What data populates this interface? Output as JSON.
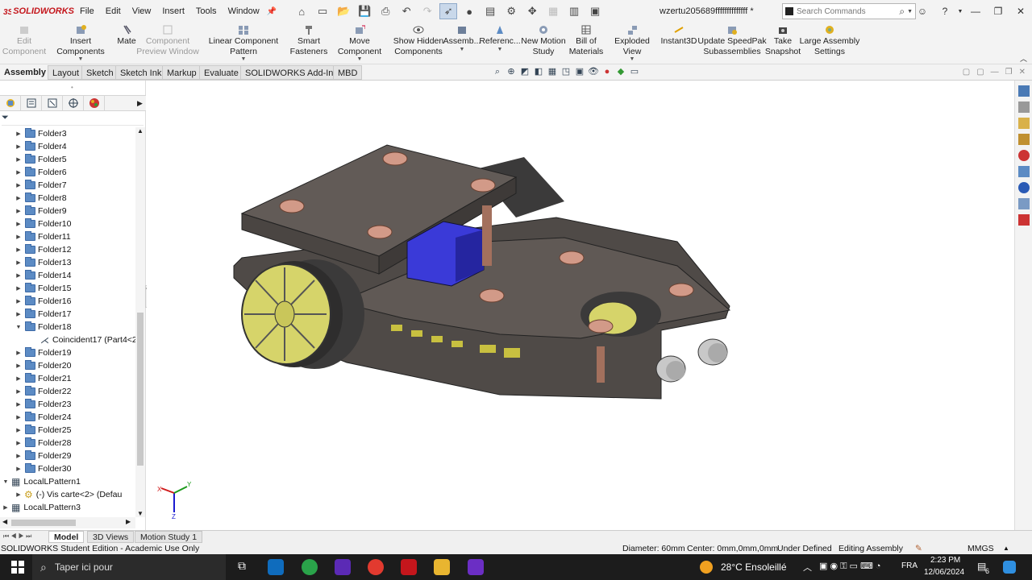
{
  "app": {
    "name": "SOLIDWORKS",
    "doc_title": "wzertu205689ffffffffffffff *"
  },
  "menu": [
    "File",
    "Edit",
    "View",
    "Insert",
    "Tools",
    "Window"
  ],
  "search": {
    "placeholder": "Search Commands"
  },
  "ribbon": [
    {
      "label": "Edit\nComponent"
    },
    {
      "label": "Insert Components"
    },
    {
      "label": "Mate"
    },
    {
      "label": "Component\nPreview Window"
    },
    {
      "label": "Linear Component Pattern"
    },
    {
      "label": "Smart\nFasteners"
    },
    {
      "label": "Move Component"
    },
    {
      "label": "Show Hidden\nComponents"
    },
    {
      "label": "Assemb..."
    },
    {
      "label": "Referenc..."
    },
    {
      "label": "New Motion\nStudy"
    },
    {
      "label": "Bill of\nMaterials"
    },
    {
      "label": "Exploded View"
    },
    {
      "label": "Instant3D"
    },
    {
      "label": "Update SpeedPak\nSubassemblies"
    },
    {
      "label": "Take\nSnapshot"
    },
    {
      "label": "Large Assembly\nSettings"
    }
  ],
  "tabs": [
    "Assembly",
    "Layout",
    "Sketch",
    "Sketch Ink",
    "Markup",
    "Evaluate",
    "SOLIDWORKS Add-Ins",
    "MBD"
  ],
  "tree": [
    "Folder3",
    "Folder4",
    "Folder5",
    "Folder6",
    "Folder7",
    "Folder8",
    "Folder9",
    "Folder10",
    "Folder11",
    "Folder12",
    "Folder13",
    "Folder14",
    "Folder15",
    "Folder16",
    "Folder17",
    "Folder18",
    "Coincident17 (Part4<2>",
    "Folder19",
    "Folder20",
    "Folder21",
    "Folder22",
    "Folder23",
    "Folder24",
    "Folder25",
    "Folder28",
    "Folder29",
    "Folder30",
    "LocalLPattern1",
    "(-) Vis carte<2> (Defau",
    "LocalLPattern3"
  ],
  "bottom_tabs": [
    "Model",
    "3D Views",
    "Motion Study 1"
  ],
  "status": {
    "left": "SOLIDWORKS Student Edition - Academic Use Only",
    "diameter": "Diameter: 60mm",
    "center": "Center: 0mm,0mm,0mm",
    "defined": "Under Defined",
    "mode": "Editing Assembly",
    "units": "MMGS"
  },
  "taskbar": {
    "search": "Taper ici pour",
    "weather": "28°C  Ensoleillé",
    "lang": "FRA",
    "time": "2:23 PM",
    "date": "12/06/2024",
    "notif": "6"
  },
  "triad": {
    "x": "X",
    "y": "Y",
    "z": "Z"
  }
}
